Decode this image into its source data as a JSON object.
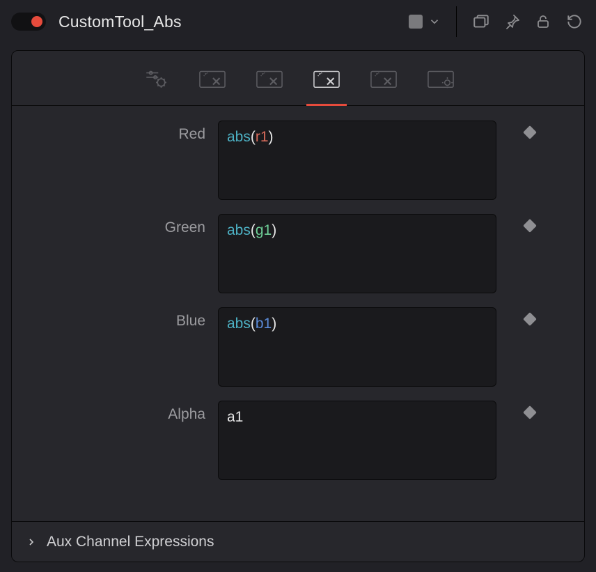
{
  "header": {
    "power_on": true,
    "title": "CustomTool_Abs",
    "color_swatch": "#7a7a7d"
  },
  "tabs": {
    "items": [
      {
        "id": "controls",
        "icon": "sliders-gear-icon"
      },
      {
        "id": "expr-r",
        "icon": "wand-panel-icon"
      },
      {
        "id": "expr-g",
        "icon": "wand-panel-icon"
      },
      {
        "id": "expr-b",
        "icon": "wand-panel-icon"
      },
      {
        "id": "expr-a",
        "icon": "wand-panel-icon"
      },
      {
        "id": "settings",
        "icon": "panel-gear-icon"
      }
    ],
    "active_index": 3
  },
  "channels": [
    {
      "label": "Red",
      "expr_html": "<span class='fn'>abs</span>(<span class='varR'>r1</span>)",
      "expr_text": "abs(r1)"
    },
    {
      "label": "Green",
      "expr_html": "<span class='fn'>abs</span>(<span class='varG'>g1</span>)",
      "expr_text": "abs(g1)"
    },
    {
      "label": "Blue",
      "expr_html": "<span class='fn'>abs</span>(<span class='varB'>b1</span>)",
      "expr_text": "abs(b1)"
    },
    {
      "label": "Alpha",
      "expr_html": "a1",
      "expr_text": "a1"
    }
  ],
  "footer": {
    "label": "Aux Channel Expressions",
    "expanded": false
  }
}
